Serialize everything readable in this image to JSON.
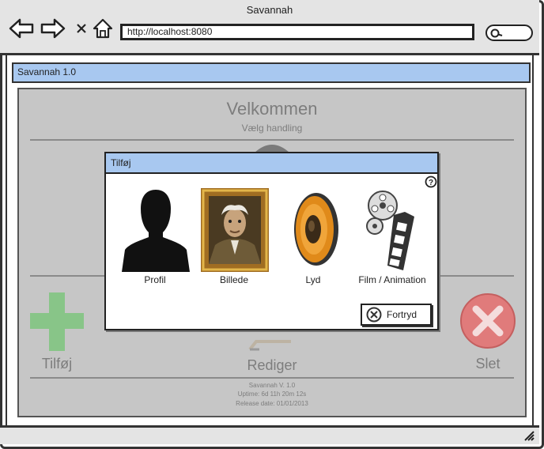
{
  "window": {
    "title": "Savannah"
  },
  "browser": {
    "back_icon": "arrow-left-icon",
    "forward_icon": "arrow-right-icon",
    "stop_icon": "close-x-icon",
    "home_icon": "home-icon",
    "url": "http://localhost:8080",
    "search_icon": "search-icon"
  },
  "app": {
    "title": "Savannah 1.0",
    "heading": "Velkommen",
    "subheading": "Vælg handling",
    "actions": {
      "add_label": "Tilføj",
      "edit_label": "Rediger",
      "delete_label": "Slet"
    },
    "footer": {
      "version": "Savannah V. 1.0",
      "uptime": "Uptime: 6d 11h 20m 12s",
      "release": "Release date: 01/01/2013"
    }
  },
  "dialog": {
    "title": "Tilføj",
    "help_icon": "help-icon",
    "options": [
      {
        "label": "Profil",
        "icon": "silhouette-icon"
      },
      {
        "label": "Billede",
        "icon": "framed-portrait-icon"
      },
      {
        "label": "Lyd",
        "icon": "speaker-icon"
      },
      {
        "label": "Film / Animation",
        "icon": "film-reel-icon"
      }
    ],
    "cancel_label": "Fortryd",
    "cancel_icon": "cancel-circle-icon"
  },
  "colors": {
    "title_bar": "#a8c8f0",
    "panel": "#c6c6c6",
    "chrome": "#e4e4e4",
    "add_green": "#7cc47c",
    "delete_red": "#e07b7b"
  }
}
